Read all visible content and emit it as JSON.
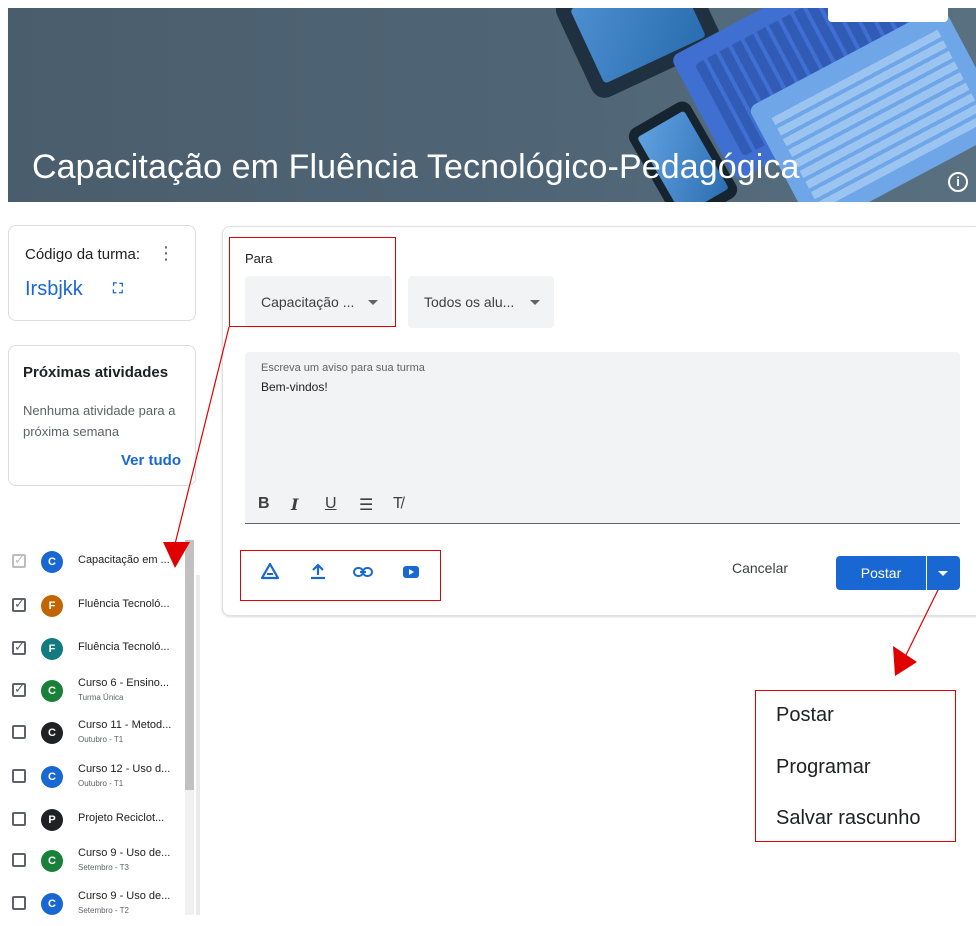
{
  "banner": {
    "title": "Capacitação em Fluência Tecnológico-Pedagógica",
    "info_icon": "info-icon"
  },
  "class_code_card": {
    "label": "Código da turma:",
    "code": "Irsbjkk",
    "more_icon": "more-vert-icon",
    "expand_icon": "fullscreen-icon"
  },
  "upcoming": {
    "title": "Próximas atividades",
    "empty_text": "Nenhuma atividade para a próxima semana",
    "link": "Ver tudo"
  },
  "class_list": [
    {
      "name": "Capacitação em ...",
      "sub": "",
      "initial": "C",
      "color": "#1967d2",
      "checked": true,
      "disabled": true
    },
    {
      "name": "Fluência Tecnoló...",
      "sub": "",
      "initial": "F",
      "color": "#c26401",
      "checked": true,
      "disabled": false
    },
    {
      "name": "Fluência Tecnoló...",
      "sub": "",
      "initial": "F",
      "color": "#137a7f",
      "checked": true,
      "disabled": false
    },
    {
      "name": "Curso 6 - Ensino...",
      "sub": "Turma Única",
      "initial": "C",
      "color": "#188038",
      "checked": true,
      "disabled": false
    },
    {
      "name": "Curso 11 - Metod...",
      "sub": "Outubro - T1",
      "initial": "C",
      "color": "#202124",
      "checked": false,
      "disabled": false
    },
    {
      "name": "Curso 12 - Uso d...",
      "sub": "Outubro - T1",
      "initial": "C",
      "color": "#1967d2",
      "checked": false,
      "disabled": false
    },
    {
      "name": "Projeto Reciclot...",
      "sub": "",
      "initial": "P",
      "color": "#202124",
      "checked": false,
      "disabled": false
    },
    {
      "name": "Curso 9 - Uso de...",
      "sub": "Setembro - T3",
      "initial": "C",
      "color": "#188038",
      "checked": false,
      "disabled": false
    },
    {
      "name": "Curso 9 - Uso de...",
      "sub": "Setembro - T2",
      "initial": "C",
      "color": "#1967d2",
      "checked": false,
      "disabled": false
    }
  ],
  "post": {
    "for_label": "Para",
    "class_select": "Capacitação ...",
    "students_select": "Todos os alu...",
    "editor_label": "Escreva um aviso para sua turma",
    "editor_text": "Bem-vindos!",
    "format_bold": "B",
    "format_italic": "I",
    "format_underline": "U",
    "format_list": "☰",
    "format_clear": "T̸",
    "attach_icons": [
      "drive-icon",
      "upload-icon",
      "link-icon",
      "youtube-icon"
    ],
    "cancel": "Cancelar",
    "post": "Postar"
  },
  "post_menu": {
    "items": [
      "Postar",
      "Programar",
      "Salvar rascunho"
    ]
  },
  "colors": {
    "accent": "#1967d2",
    "annotation": "#e00000"
  }
}
